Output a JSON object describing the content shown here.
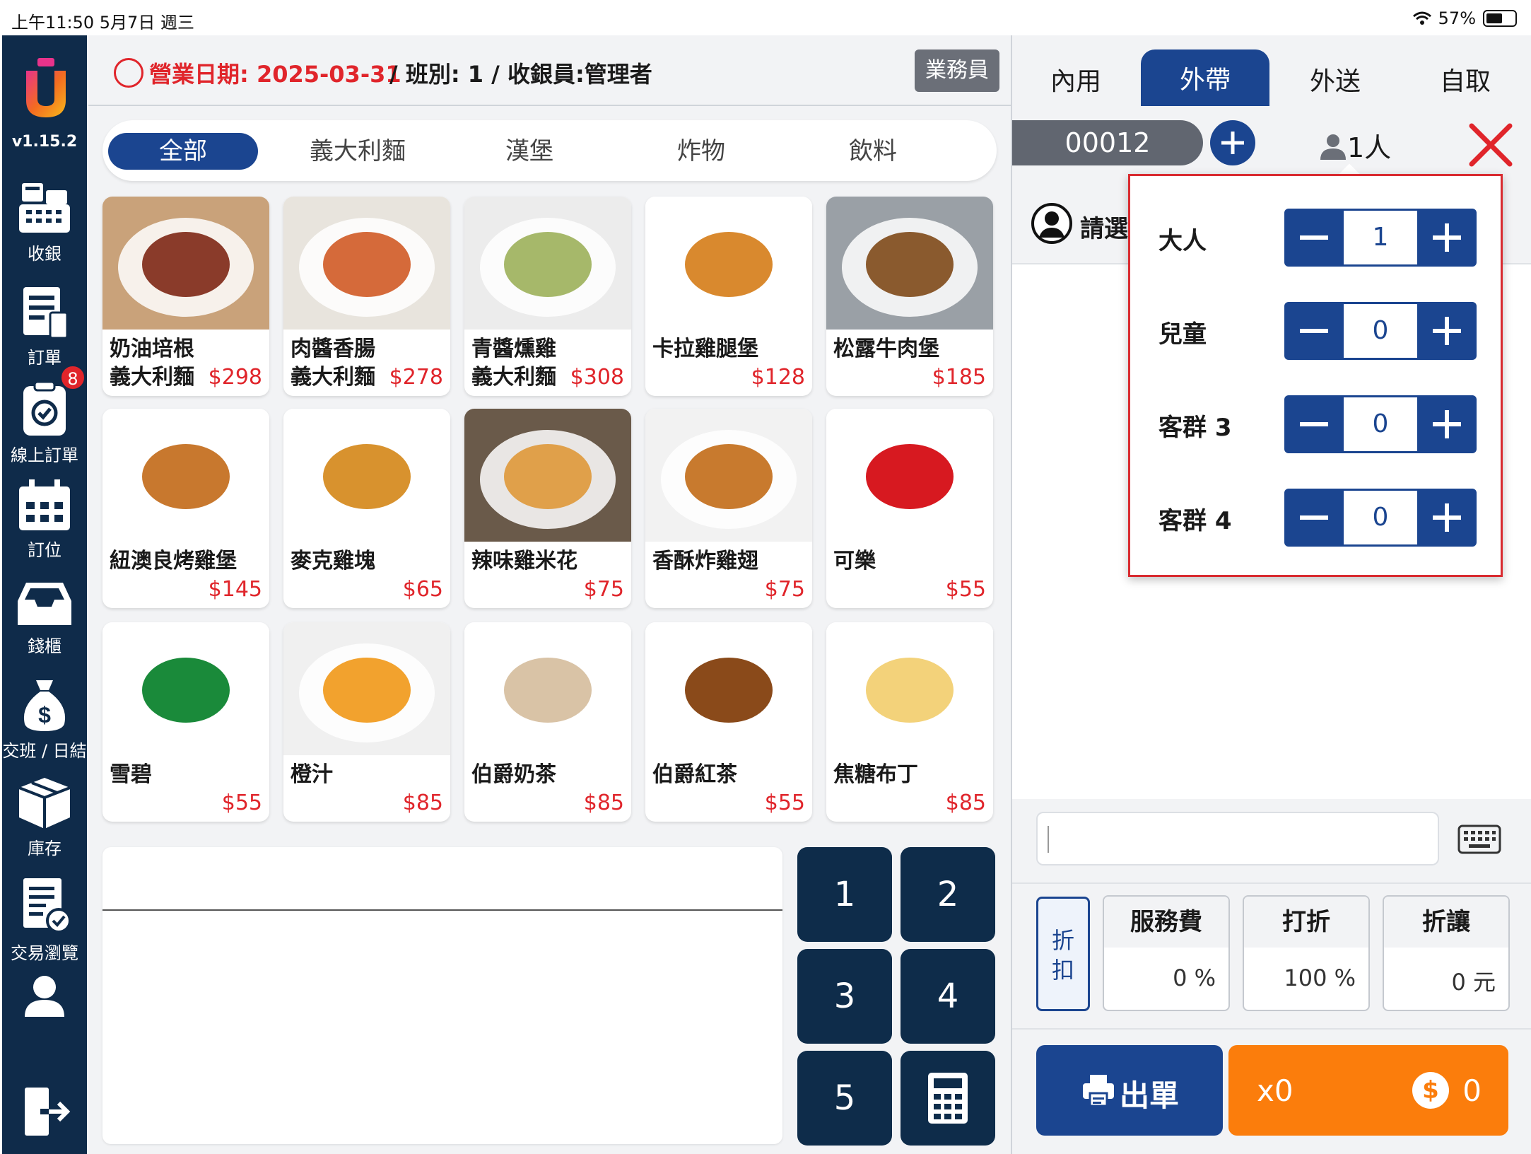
{
  "status": {
    "time": "上午11:50   5月7日 週三",
    "battery": "57%",
    "battery_fill": 0.57
  },
  "sidebar": {
    "version": "v1.15.2",
    "items": [
      {
        "label": "收銀",
        "icon": "cash-register-icon"
      },
      {
        "label": "訂單",
        "icon": "order-list-icon"
      },
      {
        "label": "線上訂單",
        "icon": "online-order-icon",
        "badge": "8"
      },
      {
        "label": "訂位",
        "icon": "calendar-icon"
      },
      {
        "label": "錢櫃",
        "icon": "cash-drawer-icon"
      },
      {
        "label": "交班 / 日結",
        "icon": "money-bag-icon"
      },
      {
        "label": "庫存",
        "icon": "inventory-box-icon"
      },
      {
        "label": "交易瀏覽",
        "icon": "receipt-check-icon"
      },
      {
        "label": "",
        "icon": "user-icon"
      },
      {
        "label": "",
        "icon": "logout-icon"
      }
    ]
  },
  "header": {
    "business_date": "營業日期: 2025-03-31",
    "shift_info": "/ 班別: 1 / 收銀員:管理者",
    "staff_button": "業務員"
  },
  "categories": [
    "全部",
    "義大利麵",
    "漢堡",
    "炸物",
    "飲料"
  ],
  "products": [
    {
      "name": "奶油培根\n義大利麵",
      "price": "$298",
      "bg": "#c9a27a",
      "fg": "#8a3b2a"
    },
    {
      "name": "肉醬香腸\n義大利麵",
      "price": "$278",
      "bg": "#e8e4dd",
      "fg": "#d56a3a"
    },
    {
      "name": "青醬燻雞\n義大利麵",
      "price": "$308",
      "bg": "#ececec",
      "fg": "#a6b86a"
    },
    {
      "name": "卡拉雞腿堡",
      "price": "$128",
      "bg": "#ffffff",
      "fg": "#d9892e"
    },
    {
      "name": "松露牛肉堡",
      "price": "$185",
      "bg": "#9aa0a6",
      "fg": "#8a5a2e"
    },
    {
      "name": "紐澳良烤雞堡",
      "price": "$145",
      "bg": "#ffffff",
      "fg": "#c8782e"
    },
    {
      "name": "麥克雞塊",
      "price": "$65",
      "bg": "#ffffff",
      "fg": "#d8922e"
    },
    {
      "name": "辣味雞米花",
      "price": "$75",
      "bg": "#6a5a4a",
      "fg": "#e0a04a"
    },
    {
      "name": "香酥炸雞翅",
      "price": "$75",
      "bg": "#f2f2f2",
      "fg": "#c87a2e"
    },
    {
      "name": "可樂",
      "price": "$55",
      "bg": "#ffffff",
      "fg": "#d71920"
    },
    {
      "name": "雪碧",
      "price": "$55",
      "bg": "#ffffff",
      "fg": "#1a8a3a"
    },
    {
      "name": "橙汁",
      "price": "$85",
      "bg": "#f0f0f0",
      "fg": "#f2a22e"
    },
    {
      "name": "伯爵奶茶",
      "price": "$85",
      "bg": "#ffffff",
      "fg": "#d9c3a6"
    },
    {
      "name": "伯爵紅茶",
      "price": "$55",
      "bg": "#ffffff",
      "fg": "#8a4a1a"
    },
    {
      "name": "焦糖布丁",
      "price": "$85",
      "bg": "#ffffff",
      "fg": "#f3d27a"
    }
  ],
  "numpad": [
    "1",
    "2",
    "3",
    "4",
    "5"
  ],
  "order_types": [
    "內用",
    "外帶",
    "外送",
    "自取"
  ],
  "order": {
    "number": "00012",
    "pax": "1人",
    "customer_prompt": "請選"
  },
  "guest_popup": {
    "rows": [
      {
        "label": "大人",
        "value": "1"
      },
      {
        "label": "兒童",
        "value": "0"
      },
      {
        "label": "客群 3",
        "value": "0"
      },
      {
        "label": "客群 4",
        "value": "0"
      }
    ]
  },
  "discount": {
    "side_label": "折\n扣",
    "service_fee": {
      "title": "服務費",
      "value": "0 %"
    },
    "percent_off": {
      "title": "打折",
      "value": "100 %"
    },
    "amount_off": {
      "title": "折讓",
      "value": "0 元"
    }
  },
  "actions": {
    "print_label": "出單",
    "count": "x0",
    "total": "0"
  },
  "colors": {
    "primary": "#1b4590",
    "sidebar": "#0f2b4a",
    "accent_red": "#e0252b",
    "pay_orange": "#fb7d0c"
  }
}
